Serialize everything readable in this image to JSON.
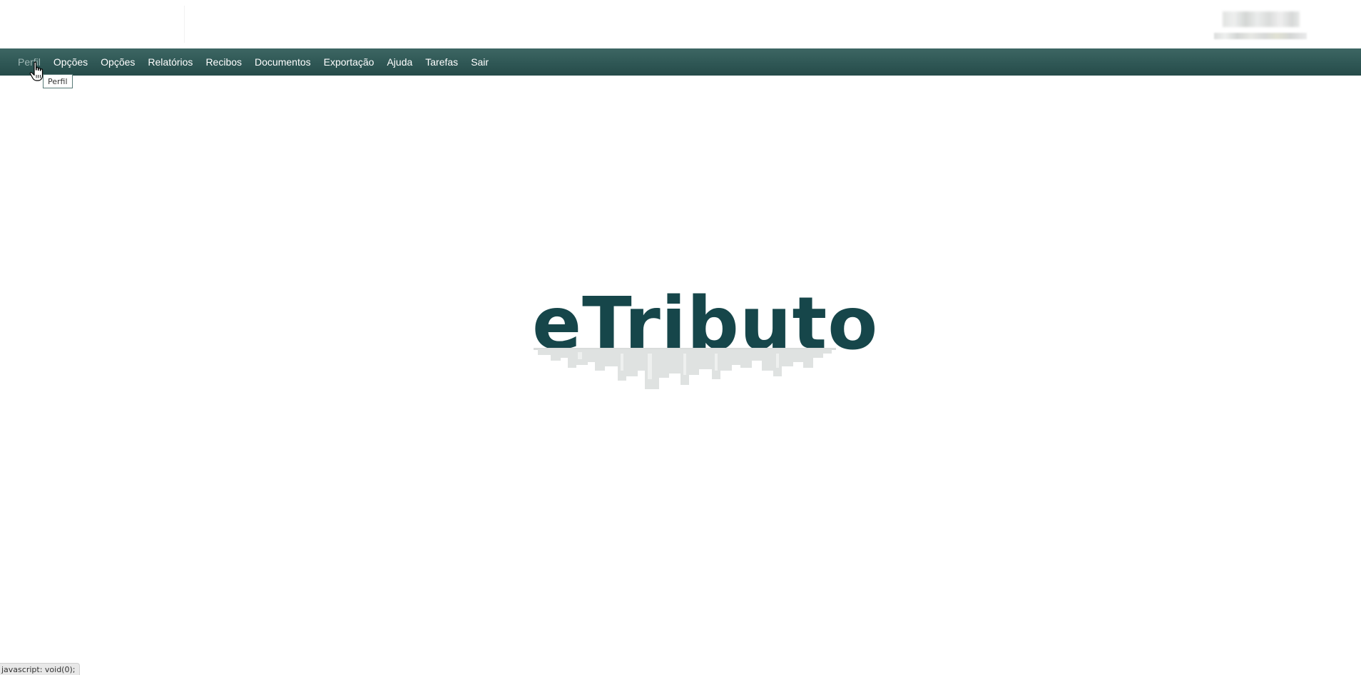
{
  "nav": {
    "items": [
      {
        "label": "Perfil"
      },
      {
        "label": "Opções"
      },
      {
        "label": "Opções"
      },
      {
        "label": "Relatórios"
      },
      {
        "label": "Recibos"
      },
      {
        "label": "Documentos"
      },
      {
        "label": "Exportação"
      },
      {
        "label": "Ajuda"
      },
      {
        "label": "Tarefas"
      },
      {
        "label": "Sair"
      }
    ],
    "hovered_index": 0
  },
  "tooltip": {
    "text": "Perfil"
  },
  "logo": {
    "text": "eTributo",
    "icon": "city-skyline-reflection"
  },
  "status": {
    "text": "javascript: void(0);"
  },
  "colors": {
    "navbar": "#2f5755",
    "logo": "#16464a",
    "nav_hover": "#9fb7b5"
  }
}
